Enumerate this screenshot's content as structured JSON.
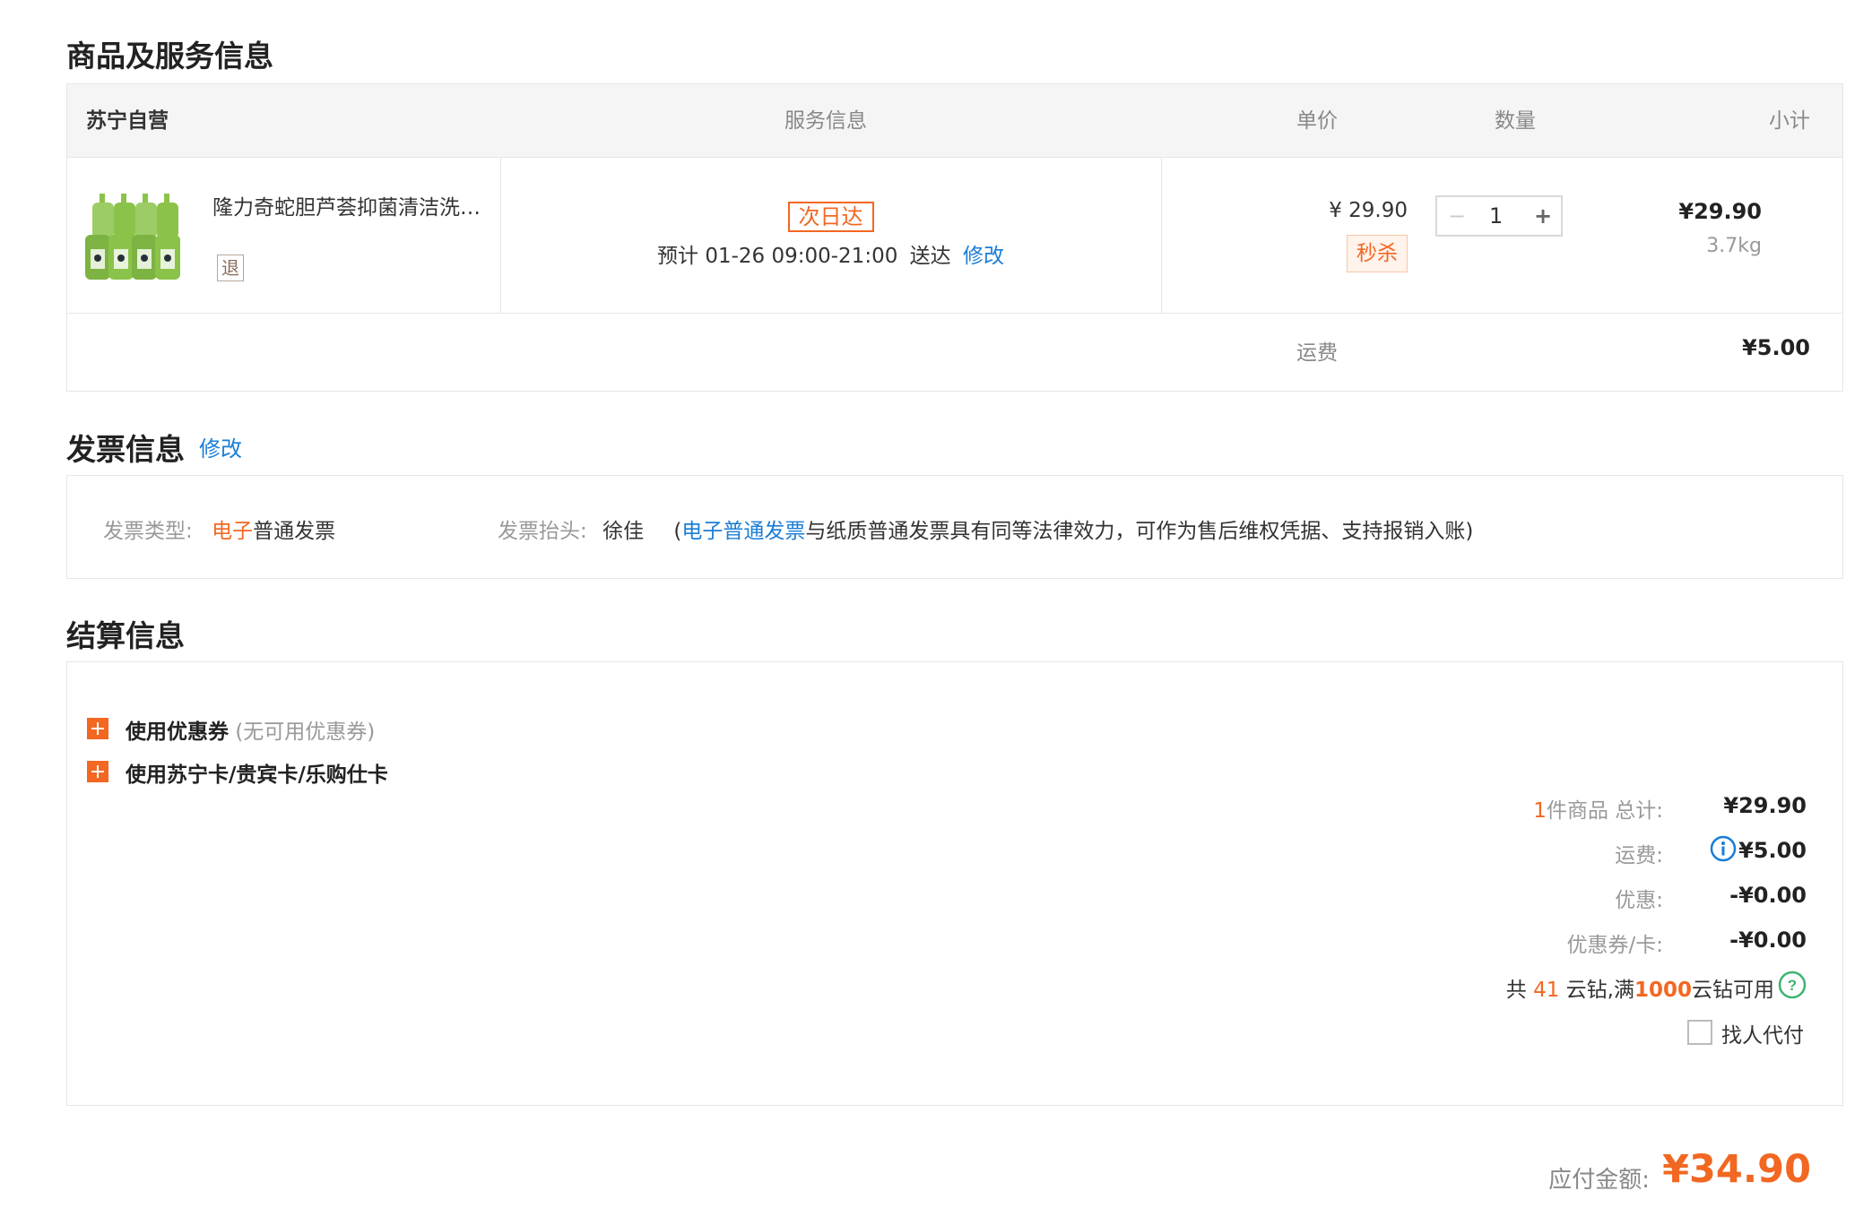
{
  "goods_section": {
    "title": "商品及服务信息",
    "header": {
      "store": "苏宁自营",
      "service": "服务信息",
      "unit_price": "单价",
      "quantity": "数量",
      "subtotal": "小计"
    },
    "item": {
      "name": "隆力奇蛇胆芦荟抑菌清洁洗…",
      "return_badge": "退",
      "delivery_tag": "次日达",
      "delivery_prefix": "预计",
      "delivery_time": "01-26 09:00-21:00",
      "delivery_suffix": "送达",
      "modify": "修改",
      "price": "¥ 29.90",
      "price_tag": "秒杀",
      "qty": "1",
      "qty_minus": "−",
      "qty_plus": "+",
      "subtotal": "¥29.90",
      "weight": "3.7kg"
    },
    "shipping_label": "运费",
    "shipping_value": "¥5.00"
  },
  "invoice_section": {
    "title": "发票信息",
    "modify": "修改",
    "type_label": "发票类型:",
    "type_value_highlight": "电子",
    "type_value_rest": "普通发票",
    "header_label": "发票抬头:",
    "header_value": "徐佳",
    "note_open": "(",
    "note_link": "电子普通发票",
    "note_rest": "与纸质普通发票具有同等法律效力，可作为售后维权凭据、支持报销入账)"
  },
  "settlement_section": {
    "title": "结算信息",
    "coupon_label": "使用优惠券",
    "coupon_note": "(无可用优惠券)",
    "card_label": "使用苏宁卡/贵宾卡/乐购仕卡",
    "summary": {
      "count": "1",
      "count_suffix": "件商品 总计:",
      "total": "¥29.90",
      "shipping_label": "运费:",
      "shipping_value": "¥5.00",
      "discount_label": "优惠:",
      "discount_value": "-¥0.00",
      "coupon_label": "优惠券/卡:",
      "coupon_value": "-¥0.00",
      "diamond_prefix": "共",
      "diamond_count": "41",
      "diamond_mid": "云钻,满",
      "diamond_threshold": "1000",
      "diamond_suffix": "云钻可用",
      "pay_for_me": "找人代付"
    }
  },
  "payable": {
    "label": "应付金额:",
    "value": "¥34.90"
  },
  "colors": {
    "accent": "#f26722",
    "link": "#1a7dd6",
    "border": "#e6e6e6"
  }
}
